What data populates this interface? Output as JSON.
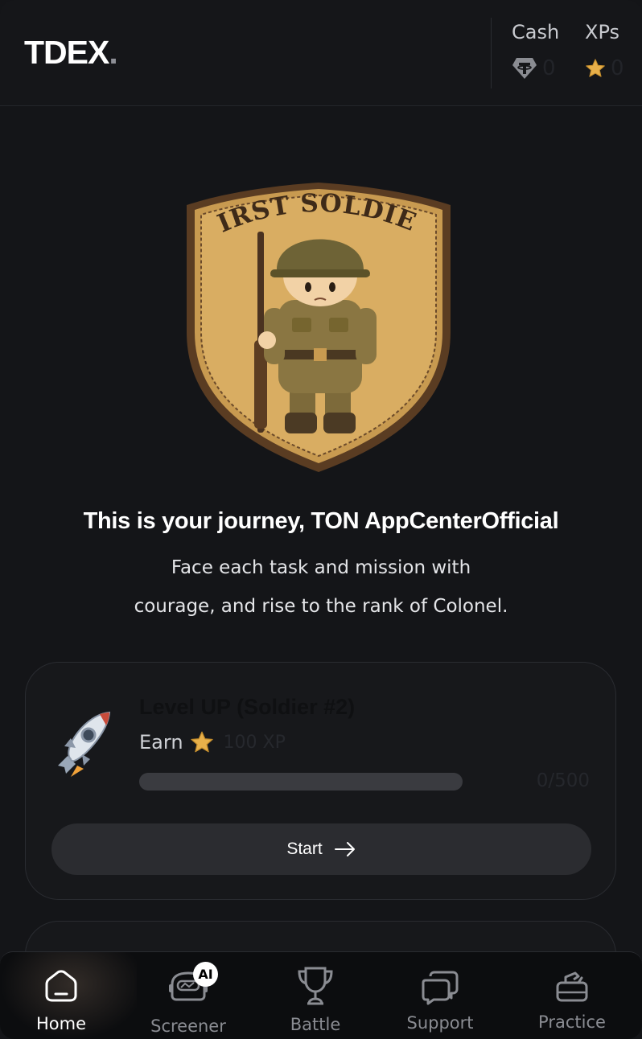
{
  "header": {
    "logo": "TDEX",
    "logo_dot": ".",
    "cash": {
      "label": "Cash",
      "value": "0",
      "icon": "tether-icon"
    },
    "xp": {
      "label": "XPs",
      "value": "0",
      "icon": "star-icon"
    }
  },
  "badge": {
    "text": "FIRST SOLDIER"
  },
  "intro": {
    "headline": "This is your journey, TON AppCenterOfficial",
    "subline_1": "Face each task and mission with",
    "subline_2": "courage, and rise to the rank of Colonel."
  },
  "mission": {
    "icon": "rocket-icon",
    "title": "Level UP (Soldier #2)",
    "earn_label": "Earn",
    "reward": "100 XP",
    "progress_text": "0/500",
    "progress_fraction": 0,
    "start_label": "Start"
  },
  "nav": {
    "items": [
      {
        "label": "Home",
        "icon": "home-icon",
        "active": true
      },
      {
        "label": "Screener",
        "icon": "screener-icon",
        "badge": "AI"
      },
      {
        "label": "Battle",
        "icon": "trophy-icon"
      },
      {
        "label": "Support",
        "icon": "chat-icon"
      },
      {
        "label": "Practice",
        "icon": "practice-icon"
      }
    ]
  },
  "colors": {
    "background": "#141518",
    "star": "#e8b04a",
    "accent_text": "#ffffff"
  }
}
